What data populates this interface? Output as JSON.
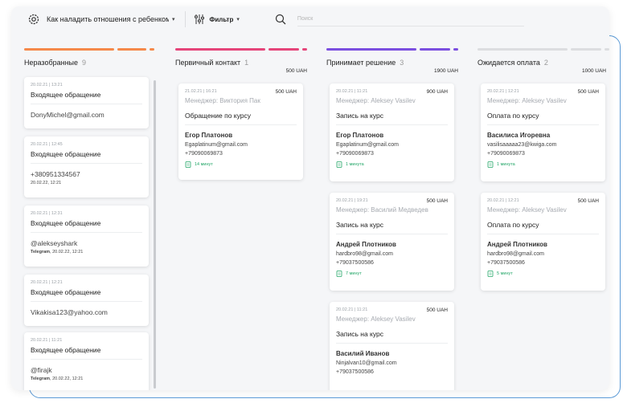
{
  "header": {
    "project": "Как наладить отношения с ребенком",
    "filter_label": "Фильтр",
    "search_placeholder": "Поиск"
  },
  "columns": [
    {
      "name": "Неразобранные",
      "count": "9",
      "total": "",
      "bar_colors": [
        "#f5894a",
        "#f5894a",
        "#f5894a"
      ],
      "cards": [
        {
          "date": "20.02.21 | 13:21",
          "title": "Входящее обращение",
          "value": "DonyMichel@gmail.com",
          "sub_bold": "",
          "sub": ""
        },
        {
          "date": "20.02.21 | 12:45",
          "title": "Входящее обращение",
          "value": "+380951334567",
          "sub_bold": "",
          "sub": "20.02.22, 12:21"
        },
        {
          "date": "20.02.21 | 12:31",
          "title": "Входящее обращение",
          "value": "@alekseyshark",
          "sub_bold": "Telegram",
          "sub": ", 20.02.22, 12:21"
        },
        {
          "date": "20.02.21 | 12:21",
          "title": "Входящее обращение",
          "value": "Vikakisa123@yahoo.com",
          "sub_bold": "",
          "sub": ""
        },
        {
          "date": "20.02.21 | 11:21",
          "title": "Входящее обращение",
          "value": "@firajk",
          "sub_bold": "Telegram",
          "sub": ", 20.02.22, 12:21"
        }
      ]
    },
    {
      "name": "Первичный контакт",
      "count": "1",
      "total": "500 UAH",
      "bar_colors": [
        "#e5457a",
        "#e5457a",
        "#e5457a"
      ],
      "cards": [
        {
          "date": "21.02.21 | 16:21",
          "price": "500 UAH",
          "manager": "Менеджер: Виктория Пак",
          "title": "Обращение по курсу",
          "name": "Егор Платонов",
          "email": "Egaplatinum@gmail.com",
          "phone": "+79090069873",
          "duration": "14 минут"
        }
      ]
    },
    {
      "name": "Принимает решение",
      "count": "3",
      "total": "1900 UAH",
      "bar_colors": [
        "#7b4fe0",
        "#7b4fe0",
        "#7b4fe0"
      ],
      "cards": [
        {
          "date": "20.02.21 | 11:21",
          "price": "900 UAH",
          "manager": "Менеджер: Aleksey Vasilev",
          "title": "Запись на курс",
          "name": "Егор Платонов",
          "email": "Egaplatinum@gmail.com",
          "phone": "+79090069873",
          "duration": "1 минута"
        },
        {
          "date": "20.02.21 | 19:21",
          "price": "500 UAH",
          "manager": "Менеджер: Василий Медведев",
          "title": "Запись на курс",
          "name": "Андрей Плотников",
          "email": "hardbro98@gmail.com",
          "phone": "+79037500586",
          "duration": "7 минут"
        },
        {
          "date": "20.02.21 | 11:21",
          "price": "500 UAH",
          "manager": "Менеджер: Aleksey Vasilev",
          "title": "Запись на курс",
          "name": "Василий Иванов",
          "email": "Ninjalvan10@gmail.com",
          "phone": "+79037500586",
          "duration": ""
        }
      ]
    },
    {
      "name": "Ожидается оплата",
      "count": "2",
      "total": "1000 UAH",
      "bar_colors": [
        "#dcdde0",
        "#dcdde0",
        "#dcdde0"
      ],
      "cards": [
        {
          "date": "20.02.21 | 12:21",
          "price": "500 UAH",
          "manager": "Менеджер: Aleksey Vasilev",
          "title": "Оплата по курсу",
          "name": "Василиса Игоревна",
          "email": "vasilisaaaaa23@kwiga.com",
          "phone": "+79090069873",
          "duration": "1 минута"
        },
        {
          "date": "20.02.21 | 12:21",
          "price": "500 UAH",
          "manager": "Менеджер: Aleksey Vasilev",
          "title": "Оплата по курсу",
          "name": "Андрей Плотников",
          "email": "hardbro98@gmail.com",
          "phone": "+79037500586",
          "duration": "5 минут"
        }
      ]
    }
  ]
}
